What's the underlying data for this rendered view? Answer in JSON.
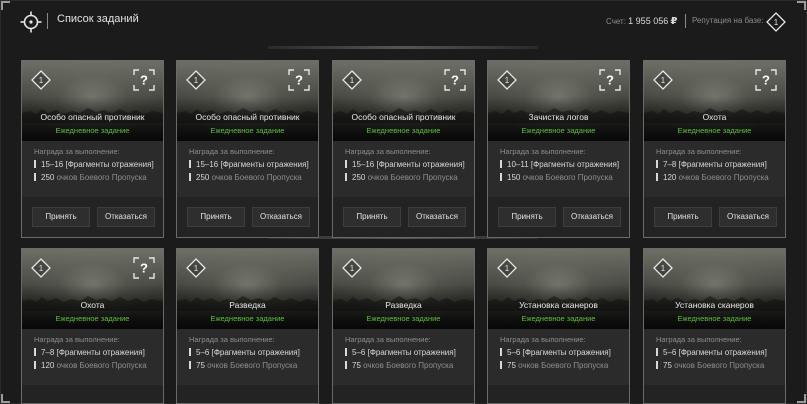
{
  "header": {
    "title": "Список заданий",
    "balance_label": "Счет:",
    "balance_value": "1 955 056",
    "currency": "₽",
    "reputation_label": "Репутация на базе:",
    "reputation_level": "1"
  },
  "card_common": {
    "reward_title": "Награда за выполнение:",
    "points_suffix": "очков Боевого Пропуска",
    "accept": "Принять",
    "decline": "Отказаться",
    "daily": "Ежедневное задание"
  },
  "cards": [
    {
      "level": "1",
      "title": "Особо опасный противник",
      "subtitle": "Ежедневное задание",
      "has_question": true,
      "reward_range": "15–16",
      "reward_item": "[Фрагменты отражения]",
      "points": "250"
    },
    {
      "level": "1",
      "title": "Особо опасный противник",
      "subtitle": "Ежедневное задание",
      "has_question": true,
      "reward_range": "15–16",
      "reward_item": "[Фрагменты отражения]",
      "points": "250"
    },
    {
      "level": "1",
      "title": "Особо опасный противник",
      "subtitle": "Ежедневное задание",
      "has_question": true,
      "reward_range": "15–16",
      "reward_item": "[Фрагменты отражения]",
      "points": "250"
    },
    {
      "level": "1",
      "title": "Зачистка логов",
      "subtitle": "Ежедневное задание",
      "has_question": true,
      "reward_range": "10–11",
      "reward_item": "[Фрагменты отражения]",
      "points": "150"
    },
    {
      "level": "1",
      "title": "Охота",
      "subtitle": "Ежедневное задание",
      "has_question": true,
      "reward_range": "7–8",
      "reward_item": "[Фрагменты отражения]",
      "points": "120"
    },
    {
      "level": "1",
      "title": "Охота",
      "subtitle": "Ежедневное задание",
      "has_question": true,
      "reward_range": "7–8",
      "reward_item": "[Фрагменты отражения]",
      "points": "120"
    },
    {
      "level": "1",
      "title": "Разведка",
      "subtitle": "Ежедневное задание",
      "has_question": false,
      "reward_range": "5–6",
      "reward_item": "[Фрагменты отражения]",
      "points": "75"
    },
    {
      "level": "1",
      "title": "Разведка",
      "subtitle": "Ежедневное задание",
      "has_question": false,
      "reward_range": "5–6",
      "reward_item": "[Фрагменты отражения]",
      "points": "75"
    },
    {
      "level": "1",
      "title": "Установка сканеров",
      "subtitle": "Ежедневное задание",
      "has_question": false,
      "reward_range": "5–6",
      "reward_item": "[Фрагменты отражения]",
      "points": "75"
    },
    {
      "level": "1",
      "title": "Установка сканеров",
      "subtitle": "Ежедневное задание",
      "has_question": false,
      "reward_range": "5–6",
      "reward_item": "[Фрагменты отражения]",
      "points": "75"
    }
  ],
  "colors": {
    "accent_green": "#5fbf3c",
    "card_border": "#6a6a6a",
    "background": "#1b1b1c"
  }
}
